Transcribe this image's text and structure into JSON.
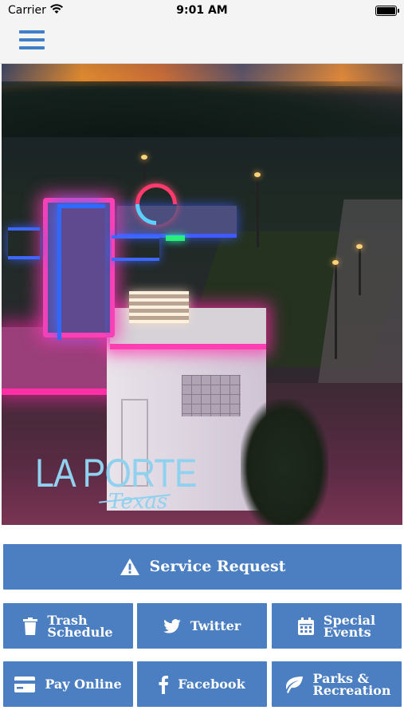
{
  "status_bar": {
    "carrier": "Carrier",
    "time": "9:01 AM"
  },
  "nav": {
    "menu_icon": "hamburger-menu-icon"
  },
  "hero": {
    "logo_title": "LA PORTE",
    "logo_subtitle": "Texas"
  },
  "buttons": {
    "service_request": {
      "label": "Service Request",
      "icon": "warning-triangle-icon"
    },
    "trash_schedule": {
      "line1": "Trash",
      "line2": "Schedule",
      "icon": "trash-icon"
    },
    "twitter": {
      "label": "Twitter",
      "icon": "twitter-icon"
    },
    "special_events": {
      "line1": "Special",
      "line2": "Events",
      "icon": "calendar-icon"
    },
    "pay_online": {
      "label": "Pay Online",
      "icon": "credit-card-icon"
    },
    "facebook": {
      "label": "Facebook",
      "icon": "facebook-icon"
    },
    "parks_recreation": {
      "line1": "Parks &",
      "line2": "Recreation",
      "icon": "leaf-icon"
    }
  },
  "colors": {
    "button_blue": "#4b7fc1",
    "menu_blue": "#3f7fc6",
    "logo_light_blue": "#8fd1ee"
  }
}
